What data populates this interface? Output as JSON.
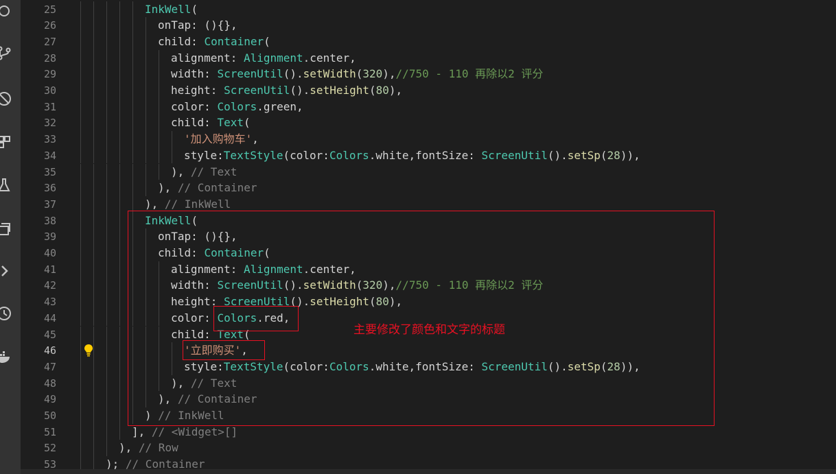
{
  "activity_bar": {
    "icons": [
      "source-control-icon",
      "git-graph-icon",
      "no-bug-icon",
      "extensions-icon",
      "test-flask-icon",
      "layers-icon",
      "chevron-right-icon",
      "timeline-icon",
      "docker-icon"
    ]
  },
  "colors": {
    "editor_bg": "#1e1e1e",
    "annotation_red": "#e81123",
    "keyword_class": "#4ec9b0",
    "function": "#dcdcaa",
    "number": "#b5cea8",
    "string": "#ce9178",
    "comment": "#6a9955"
  },
  "editor": {
    "active_line": "46",
    "lines": [
      {
        "no": "25",
        "t": "InkWell("
      },
      {
        "no": "26",
        "t": "onTap: (){},"
      },
      {
        "no": "27",
        "t": "child: Container("
      },
      {
        "no": "28",
        "t": "alignment: Alignment.center,"
      },
      {
        "no": "29",
        "t": "width: ScreenUtil().setWidth(320),//750 - 110 再除以2 评分"
      },
      {
        "no": "30",
        "t": "height: ScreenUtil().setHeight(80),"
      },
      {
        "no": "31",
        "t": "color: Colors.green,"
      },
      {
        "no": "32",
        "t": "child: Text("
      },
      {
        "no": "33",
        "t": "'加入购物车',"
      },
      {
        "no": "34",
        "t": "style:TextStyle(color:Colors.white,fontSize: ScreenUtil().setSp(28)),"
      },
      {
        "no": "35",
        "t": "), // Text"
      },
      {
        "no": "36",
        "t": "), // Container"
      },
      {
        "no": "37",
        "t": "), // InkWell"
      },
      {
        "no": "38",
        "t": "InkWell("
      },
      {
        "no": "39",
        "t": "onTap: (){},"
      },
      {
        "no": "40",
        "t": "child: Container("
      },
      {
        "no": "41",
        "t": "alignment: Alignment.center,"
      },
      {
        "no": "42",
        "t": "width: ScreenUtil().setWidth(320),//750 - 110 再除以2 评分"
      },
      {
        "no": "43",
        "t": "height: ScreenUtil().setHeight(80),"
      },
      {
        "no": "44",
        "t": "color: Colors.red,"
      },
      {
        "no": "45",
        "t": "child: Text("
      },
      {
        "no": "46",
        "t": "'立即购买',"
      },
      {
        "no": "47",
        "t": "style:TextStyle(color:Colors.white,fontSize: ScreenUtil().setSp(28)),"
      },
      {
        "no": "48",
        "t": "), // Text"
      },
      {
        "no": "49",
        "t": "), // Container"
      },
      {
        "no": "50",
        "t": ") // InkWell"
      },
      {
        "no": "51",
        "t": "], // <Widget>[]"
      },
      {
        "no": "52",
        "t": "), // Row"
      },
      {
        "no": "53",
        "t": "); // Container"
      }
    ]
  },
  "annotation": {
    "note": "主要修改了颜色和文字的标题"
  }
}
